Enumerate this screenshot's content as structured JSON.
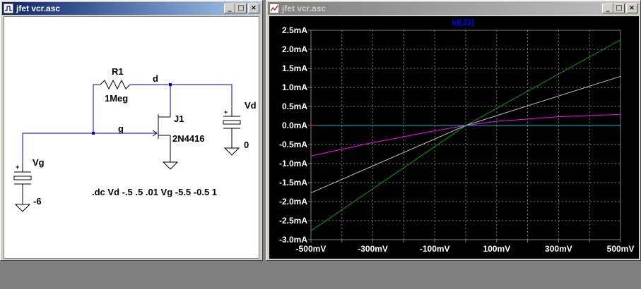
{
  "schematic_window": {
    "title": "jfet vcr.asc",
    "buttons": {
      "minimize": "_",
      "maximize": "□",
      "close": "×"
    }
  },
  "plot_window": {
    "title": "jfet vcr.asc",
    "buttons": {
      "minimize": "_",
      "maximize": "□",
      "close": "×"
    }
  },
  "schematic": {
    "R1_name": "R1",
    "R1_value": "1Meg",
    "node_d": "d",
    "node_g": "g",
    "J1_name": "J1",
    "J1_model": "2N4416",
    "Vd_name": "Vd",
    "Vd_value": "0",
    "Vg_name": "Vg",
    "Vg_value": "-6",
    "plus_vd": "+",
    "plus_vg": "+",
    "directive": ".dc Vd -.5 .5 .01 Vg -5.5 -0.5 1"
  },
  "chart_data": {
    "type": "line",
    "title": "Id(J1)",
    "xlabel": "",
    "ylabel": "",
    "x_ticks": [
      "-500mV",
      "-300mV",
      "-100mV",
      "100mV",
      "300mV",
      "500mV"
    ],
    "y_ticks": [
      "2.5mA",
      "2.0mA",
      "1.5mA",
      "1.0mA",
      "0.5mA",
      "0.0mA",
      "-0.5mA",
      "-1.0mA",
      "-1.5mA",
      "-2.0mA",
      "-2.5mA",
      "-3.0mA"
    ],
    "xlim": [
      -500,
      500
    ],
    "ylim": [
      -3.0,
      2.5
    ],
    "x_unit": "mV",
    "y_unit": "mA",
    "grid": true,
    "background": "#000000",
    "series": [
      {
        "color": "#00a000",
        "x": [
          -500,
          0,
          500
        ],
        "y": [
          -2.77,
          0,
          2.25
        ]
      },
      {
        "color": "#c0c0c0",
        "x": [
          -500,
          0,
          500
        ],
        "y": [
          -1.77,
          0,
          1.29
        ]
      },
      {
        "color": "#ff00ff",
        "x": [
          -500,
          -300,
          -100,
          0,
          100,
          300,
          500
        ],
        "y": [
          -0.8,
          -0.45,
          -0.14,
          0,
          0.11,
          0.23,
          0.29
        ]
      },
      {
        "color": "#00c0c0",
        "x": [
          -500,
          500
        ],
        "y": [
          0,
          0
        ]
      },
      {
        "color": "#ff4000",
        "x": [
          -500,
          -480
        ],
        "y": [
          0,
          0
        ]
      }
    ]
  }
}
